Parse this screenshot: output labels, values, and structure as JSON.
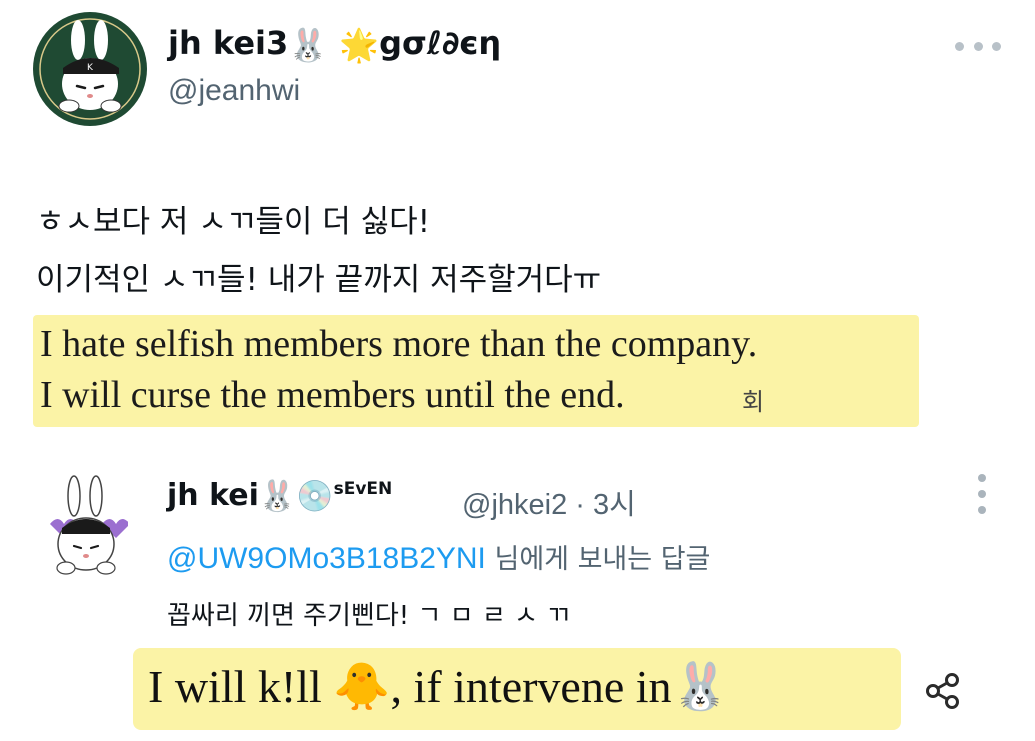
{
  "main_tweet": {
    "display_name": "jh kei3",
    "name_emoji_1": "🐰",
    "name_emoji_2": "🌟",
    "name_suffix": "gσℓ∂єη",
    "handle": "@jeanhwi",
    "more_label": "More",
    "korean_lines": [
      "ㅎㅅ보다 저 ㅅㄲ들이 더 싫다!",
      "이기적인 ㅅㄲ들! 내가 끝까지 저주할거다ㅠ"
    ],
    "translation_lines": [
      "I hate selfish members more than the company.",
      "I will curse the members until the end."
    ],
    "trailing_char": "회"
  },
  "reply": {
    "display_name": "jh kei",
    "name_emoji_1": "🐰",
    "name_emoji_2": "💿",
    "name_tag": "sEvEN",
    "meta": "@jhkei2 · 3시",
    "mention_handle": "@UW9OMo3B18B2YNI",
    "mention_tail": " 님에게 보내는 답글",
    "korean_text": "꼽싸리 끼면 주기삔다! ㄱ ㅁ ㄹ ㅅ ㄲ",
    "translation_text": "I will k!ll 🐥, if intervene in🐰",
    "share_label": "Share"
  },
  "colors": {
    "highlight": "#fbf3a6",
    "link": "#1d9bf0",
    "secondary_text": "#536471",
    "avatar_green": "#1f4a33"
  }
}
